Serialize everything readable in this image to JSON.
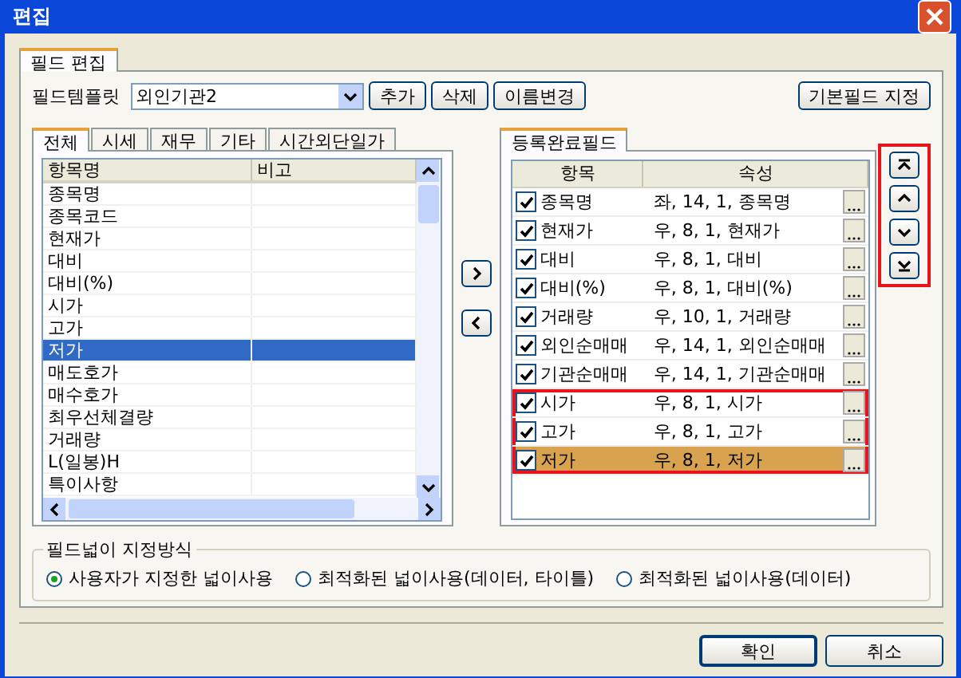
{
  "window": {
    "title": "편집"
  },
  "outer_tabs": [
    {
      "label": "필드 편집",
      "selected": true
    }
  ],
  "template": {
    "label": "필드템플릿",
    "value": "외인기관2"
  },
  "template_buttons": [
    "추가",
    "삭제",
    "이름변경"
  ],
  "default_button": "기본필드 지정",
  "left_tabs": [
    {
      "label": "전체",
      "selected": true
    },
    {
      "label": "시세",
      "selected": false
    },
    {
      "label": "재무",
      "selected": false
    },
    {
      "label": "기타",
      "selected": false
    },
    {
      "label": "시간외단일가",
      "selected": false
    }
  ],
  "left_list": {
    "columns": [
      "항목명",
      "비고"
    ],
    "rows": [
      {
        "name": "종목명",
        "selected": false
      },
      {
        "name": "종목코드",
        "selected": false
      },
      {
        "name": "현재가",
        "selected": false
      },
      {
        "name": "대비",
        "selected": false
      },
      {
        "name": "대비(%)",
        "selected": false
      },
      {
        "name": "시가",
        "selected": false
      },
      {
        "name": "고가",
        "selected": false
      },
      {
        "name": "저가",
        "selected": true
      },
      {
        "name": "매도호가",
        "selected": false
      },
      {
        "name": "매수호가",
        "selected": false
      },
      {
        "name": "최우선체결량",
        "selected": false
      },
      {
        "name": "거래량",
        "selected": false
      },
      {
        "name": "L(일봉)H",
        "selected": false
      },
      {
        "name": "특이사항",
        "selected": false
      }
    ]
  },
  "right_tabs": [
    {
      "label": "등록완료필드",
      "selected": true
    }
  ],
  "right_table": {
    "columns": [
      "항목",
      "속성"
    ],
    "rows": [
      {
        "name": "종목명",
        "attr": "좌, 14, 1, 종목명",
        "checked": true,
        "selected": false,
        "highlighted": false
      },
      {
        "name": "현재가",
        "attr": "우, 8, 1, 현재가",
        "checked": true,
        "selected": false,
        "highlighted": false
      },
      {
        "name": "대비",
        "attr": "우, 8, 1, 대비",
        "checked": true,
        "selected": false,
        "highlighted": false
      },
      {
        "name": "대비(%)",
        "attr": "우, 8, 1, 대비(%)",
        "checked": true,
        "selected": false,
        "highlighted": false
      },
      {
        "name": "거래량",
        "attr": "우, 10, 1, 거래량",
        "checked": true,
        "selected": false,
        "highlighted": false
      },
      {
        "name": "외인순매매",
        "attr": "우, 14, 1, 외인순매매",
        "checked": true,
        "selected": false,
        "highlighted": false
      },
      {
        "name": "기관순매매",
        "attr": "우, 14, 1, 기관순매매",
        "checked": true,
        "selected": false,
        "highlighted": false
      },
      {
        "name": "시가",
        "attr": "우, 8, 1, 시가",
        "checked": true,
        "selected": false,
        "highlighted": true
      },
      {
        "name": "고가",
        "attr": "우, 8, 1, 고가",
        "checked": true,
        "selected": false,
        "highlighted": true
      },
      {
        "name": "저가",
        "attr": "우, 8, 1, 저가",
        "checked": true,
        "selected": true,
        "highlighted": true
      }
    ]
  },
  "order_buttons": {
    "highlighted": true
  },
  "width_mode": {
    "title": "필드넓이 지정방식",
    "options": [
      {
        "label": "사용자가 지정한 넓이사용",
        "selected": true
      },
      {
        "label": "최적화된 넓이사용(데이터, 타이틀)",
        "selected": false
      },
      {
        "label": "최적화된 넓이사용(데이터)",
        "selected": false
      }
    ]
  },
  "buttons": [
    "확인",
    "취소"
  ]
}
